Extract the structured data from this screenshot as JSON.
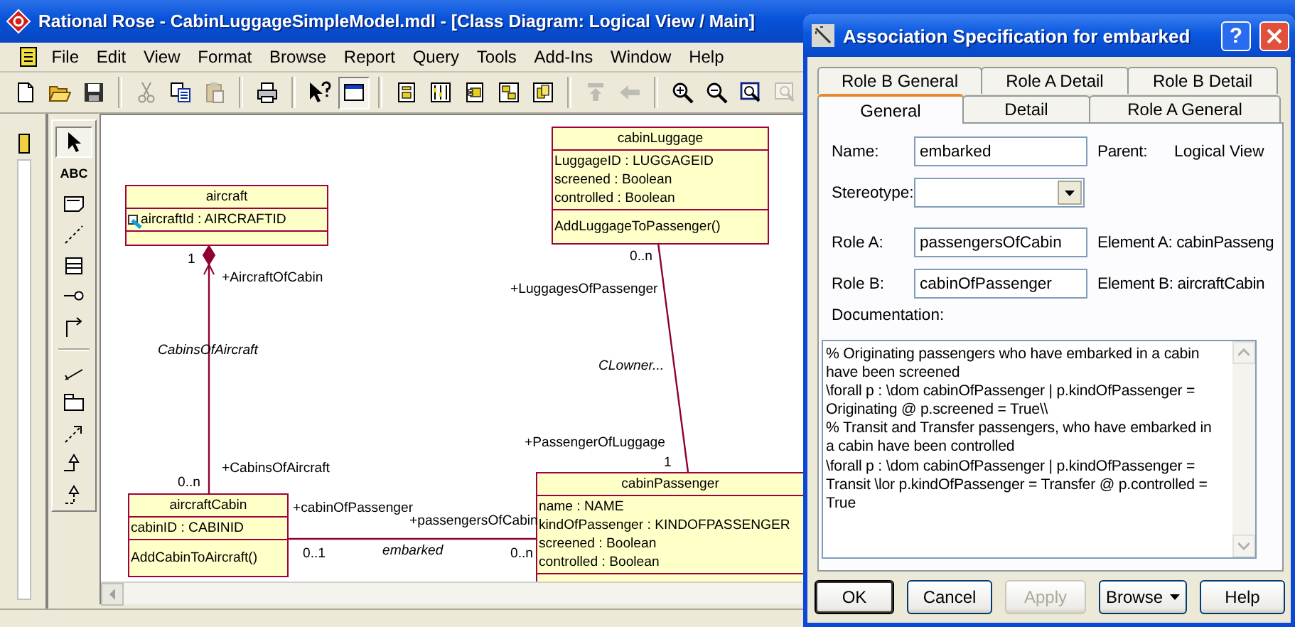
{
  "window": {
    "title": "Rational Rose - CabinLuggageSimpleModel.mdl - [Class Diagram: Logical View / Main]"
  },
  "menu": [
    "File",
    "Edit",
    "View",
    "Format",
    "Browse",
    "Report",
    "Query",
    "Tools",
    "Add-Ins",
    "Window",
    "Help"
  ],
  "toolbar": [
    {
      "kind": "new",
      "disabled": false,
      "on": false
    },
    {
      "kind": "open",
      "disabled": false,
      "on": false
    },
    {
      "kind": "save",
      "disabled": false,
      "on": false
    },
    {
      "kind": "separator"
    },
    {
      "kind": "cut",
      "disabled": true,
      "on": false
    },
    {
      "kind": "copy",
      "disabled": false,
      "on": false
    },
    {
      "kind": "paste",
      "disabled": true,
      "on": false
    },
    {
      "kind": "separator"
    },
    {
      "kind": "print",
      "disabled": false,
      "on": false
    },
    {
      "kind": "separator"
    },
    {
      "kind": "context-help",
      "disabled": false,
      "on": false
    },
    {
      "kind": "browser",
      "disabled": false,
      "on": true
    },
    {
      "kind": "separator"
    },
    {
      "kind": "diagram-a",
      "disabled": false,
      "on": false
    },
    {
      "kind": "diagram-b",
      "disabled": false,
      "on": false
    },
    {
      "kind": "diagram-c",
      "disabled": false,
      "on": false
    },
    {
      "kind": "diagram-d",
      "disabled": false,
      "on": false
    },
    {
      "kind": "diagram-e",
      "disabled": false,
      "on": false
    },
    {
      "kind": "separator"
    },
    {
      "kind": "up",
      "disabled": true,
      "on": false
    },
    {
      "kind": "back",
      "disabled": true,
      "on": false
    },
    {
      "kind": "separator"
    },
    {
      "kind": "zoom-in",
      "disabled": false,
      "on": false
    },
    {
      "kind": "zoom-out",
      "disabled": false,
      "on": false
    },
    {
      "kind": "fit",
      "disabled": false,
      "on": false
    },
    {
      "kind": "zoom-page",
      "disabled": true,
      "on": false
    }
  ],
  "toolbox": [
    {
      "kind": "select",
      "selected": true
    },
    {
      "kind": "text",
      "label": "ABC",
      "selected": false
    },
    {
      "kind": "note",
      "selected": false
    },
    {
      "kind": "anchor",
      "selected": false
    },
    {
      "kind": "class",
      "selected": false
    },
    {
      "kind": "interface",
      "selected": false
    },
    {
      "kind": "association",
      "selected": false
    },
    {
      "kind": "separator"
    },
    {
      "kind": "unidirectional",
      "selected": false
    },
    {
      "kind": "package",
      "selected": false
    },
    {
      "kind": "dependency",
      "selected": false
    },
    {
      "kind": "generalization",
      "selected": false
    },
    {
      "kind": "realization",
      "selected": false
    }
  ],
  "diagram": {
    "classes": [
      {
        "name": "aircraft",
        "attributes": [
          {
            "text": "aircraftId : AIRCRAFTID",
            "kind": "key"
          }
        ]
      },
      {
        "name": "cabinLuggage",
        "attributes": [
          {
            "text": "LuggageID : LUGGAGEID",
            "kind": "plain"
          },
          {
            "text": "screened : Boolean",
            "kind": "plain"
          },
          {
            "text": "controlled : Boolean",
            "kind": "plain"
          }
        ],
        "operations": [
          "AddLuggageToPassenger()"
        ]
      },
      {
        "name": "aircraftCabin",
        "attributes": [
          {
            "text": "cabinID : CABINID",
            "kind": "plain"
          }
        ],
        "operations": [
          "AddCabinToAircraft()"
        ]
      },
      {
        "name": "cabinPassenger",
        "attributes": [
          {
            "text": "name : NAME",
            "kind": "plain"
          },
          {
            "text": "kindOfPassenger : KINDOFPASSENGER",
            "kind": "plain"
          },
          {
            "text": "screened : Boolean",
            "kind": "plain"
          },
          {
            "text": "controlled : Boolean",
            "kind": "plain"
          }
        ]
      }
    ],
    "associations": [
      {
        "name": "CabinsOfAircraft",
        "composition": true,
        "end_a": {
          "role": "+AircraftOfCabin",
          "multiplicity": "1"
        },
        "end_b": {
          "role": "+CabinsOfAircraft",
          "multiplicity": "0..n"
        }
      },
      {
        "name": "CLowner...",
        "composition": false,
        "end_a": {
          "role": "+LuggagesOfPassenger",
          "multiplicity": "0..n"
        },
        "end_b": {
          "role": "+PassengerOfLuggage",
          "multiplicity": "1"
        }
      },
      {
        "name": "embarked",
        "composition": false,
        "end_a": {
          "role": "+cabinOfPassenger",
          "multiplicity": "0..1"
        },
        "end_b": {
          "role": "+passengersOfCabin",
          "multiplicity": "0..n"
        }
      }
    ]
  },
  "dialog": {
    "title": "Association Specification for embarked",
    "help_glyph": "?",
    "tab_rows": [
      [
        {
          "label": "Role B General",
          "selected": false
        },
        {
          "label": "Role A Detail",
          "selected": false
        },
        {
          "label": "Role B Detail",
          "selected": false
        }
      ],
      [
        {
          "label": "General",
          "selected": true
        },
        {
          "label": "Detail",
          "selected": false
        },
        {
          "label": "Role A General",
          "selected": false
        }
      ]
    ],
    "name": {
      "label": "Name:",
      "value": "embarked"
    },
    "parent": {
      "label": "Parent:",
      "value": "Logical View"
    },
    "stereotype": {
      "label": "Stereotype:"
    },
    "role_a": {
      "label": "Role A:",
      "value": "passengersOfCabin",
      "element": "Element A: cabinPasseng"
    },
    "role_b": {
      "label": "Role B:",
      "value": "cabinOfPassenger",
      "element": "Element B: aircraftCabin"
    },
    "documentation": {
      "label": "Documentation:",
      "lines": [
        "% Originating passengers who have embarked in a cabin",
        "have been screened",
        "\\forall p : \\dom cabinOfPassenger | p.kindOfPassenger =",
        "Originating @ p.screened = True\\\\",
        "% Transit and Transfer passengers, who have embarked in",
        "a cabin have been controlled",
        "\\forall p : \\dom cabinOfPassenger | p.kindOfPassenger =",
        "Transit \\lor p.kindOfPassenger = Transfer @ p.controlled =",
        "True"
      ]
    },
    "buttons": [
      {
        "label": "OK",
        "kind": "default",
        "disabled": false
      },
      {
        "label": "Cancel",
        "kind": "plain",
        "disabled": false
      },
      {
        "label": "Apply",
        "kind": "plain",
        "disabled": true
      },
      {
        "label": "Browse",
        "kind": "menu",
        "disabled": false
      },
      {
        "label": "Help",
        "kind": "plain",
        "disabled": false
      }
    ]
  }
}
